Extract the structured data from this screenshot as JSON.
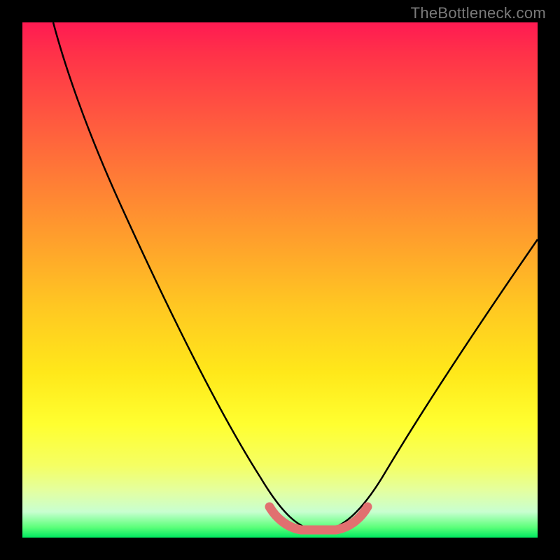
{
  "watermark": "TheBottleneck.com",
  "chart_data": {
    "type": "line",
    "title": "",
    "xlabel": "",
    "ylabel": "",
    "xlim": [
      0,
      100
    ],
    "ylim": [
      0,
      100
    ],
    "background_gradient": {
      "direction": "vertical",
      "stops": [
        {
          "pos": 0,
          "color": "#ff1a52"
        },
        {
          "pos": 18,
          "color": "#ff5640"
        },
        {
          "pos": 42,
          "color": "#ff9f2c"
        },
        {
          "pos": 68,
          "color": "#ffe81a"
        },
        {
          "pos": 86,
          "color": "#f5ff63"
        },
        {
          "pos": 95,
          "color": "#c8ffd0"
        },
        {
          "pos": 100,
          "color": "#00e860"
        }
      ]
    },
    "series": [
      {
        "name": "bottleneck-curve",
        "role": "primary-v-curve",
        "color": "#000000",
        "approx_points": [
          {
            "x": 6,
            "y": 100
          },
          {
            "x": 12,
            "y": 85
          },
          {
            "x": 22,
            "y": 62
          },
          {
            "x": 32,
            "y": 42
          },
          {
            "x": 42,
            "y": 22
          },
          {
            "x": 48,
            "y": 8
          },
          {
            "x": 52,
            "y": 2
          },
          {
            "x": 58,
            "y": 0
          },
          {
            "x": 64,
            "y": 2
          },
          {
            "x": 72,
            "y": 12
          },
          {
            "x": 82,
            "y": 28
          },
          {
            "x": 92,
            "y": 44
          },
          {
            "x": 100,
            "y": 58
          }
        ]
      },
      {
        "name": "optimal-zone-marker",
        "role": "valley-highlight",
        "color": "#e17070",
        "approx_points": [
          {
            "x": 49,
            "y": 6
          },
          {
            "x": 51,
            "y": 3
          },
          {
            "x": 55,
            "y": 1
          },
          {
            "x": 59,
            "y": 1
          },
          {
            "x": 63,
            "y": 3
          },
          {
            "x": 65,
            "y": 6
          }
        ]
      }
    ]
  }
}
